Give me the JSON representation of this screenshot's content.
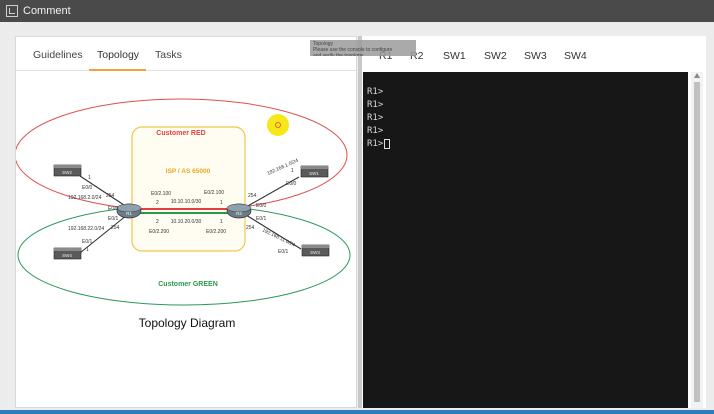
{
  "window": {
    "title": "Comment"
  },
  "left_tabs": [
    {
      "label": "Guidelines"
    },
    {
      "label": "Topology"
    },
    {
      "label": "Tasks"
    }
  ],
  "device_tabs": [
    {
      "label": "R1"
    },
    {
      "label": "R2"
    },
    {
      "label": "SW1"
    },
    {
      "label": "SW2"
    },
    {
      "label": "SW3"
    },
    {
      "label": "SW4"
    }
  ],
  "tooltip": {
    "text": "Topology\nPlease use the console to configure\nand verify the topology"
  },
  "console": {
    "lines": [
      "R1>",
      "R1>",
      "R1>",
      "R1>",
      "R1>"
    ]
  },
  "diagram": {
    "caption": "Topology Diagram",
    "customer_red": "Customer RED",
    "customer_green": "Customer GREEN",
    "core_label": "ISP / AS 65000",
    "core_link_red": "10.10.10.0/30",
    "core_link_green": "10.10.20.0/30",
    "r1_if_top": "E0/2.100",
    "r1_if_bottom": "E0/2.200",
    "r2_if_top": "E0/2.100",
    "r2_if_bottom": "E0/2.200",
    "left_net_top": "192.168.2.0/24",
    "left_net_bottom": "192.168.22.0/24",
    "right_net_top": "192.168.1.0/24",
    "right_net_bottom": "192.168.11.0/24",
    "r1_name": "R1",
    "r2_name": "R2",
    "sw_tl": "SW2",
    "sw_bl": "SW4",
    "sw_tr": "SW1",
    "sw_br": "SW3",
    "port_tl": "E0/0",
    "port_bl": "E0/1",
    "port_tr": "E0/0",
    "port_br": "E0/1",
    "r1_port_red": "E0/0",
    "r1_port_green": "E0/1",
    "r2_port_red": "E0/0",
    "r2_port_green": "E0/1",
    "host_254_a": "254",
    "host_254_b": "254",
    "host_254_c": "254",
    "host_254_d": "254",
    "host_1_a": "1",
    "host_1_b": "1",
    "host_1_c": "1",
    "host_2_a": "2",
    "host_2_b": "2",
    "host_1_d": "1",
    "host_1_e": "1"
  },
  "colors": {
    "red_link": "#e04040",
    "green_link": "#2a9a4a",
    "core_box": "#f2c44a",
    "highlight": "#f5e400"
  }
}
